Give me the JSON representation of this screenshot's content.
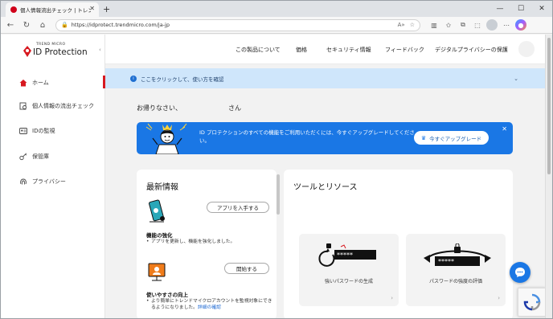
{
  "browser": {
    "tab_title": "個人情報流出チェック | トレンドマイクロ",
    "url": "https://idprotect.trendmicro.com/ja-jp",
    "window_controls": [
      "—",
      "☐",
      "✕"
    ]
  },
  "logo": {
    "small": "TREND MICRO",
    "big": "ID Protection"
  },
  "sidebar": {
    "items": [
      {
        "label": "ホーム",
        "icon": "home-icon"
      },
      {
        "label": "個人情報の流出チェック",
        "icon": "leak-check-icon"
      },
      {
        "label": "IDの監視",
        "icon": "id-card-icon"
      },
      {
        "label": "保管庫",
        "icon": "key-icon"
      },
      {
        "label": "プライバシー",
        "icon": "fingerprint-icon"
      }
    ]
  },
  "topnav": {
    "items": [
      "この製品について",
      "価格",
      "セキュリティ情報",
      "フィードバック",
      "デジタルプライバシーの保護"
    ]
  },
  "info_banner": {
    "text": "ここをクリックして、使い方を確認"
  },
  "greeting": {
    "prefix": "お帰りなさい、",
    "suffix": "さん"
  },
  "upgrade": {
    "text": "ID プロテクションのすべての機能をご利用いただくには、今すぐアップグレードしてください。",
    "button": "今すぐアップグレード",
    "accent": "#1a77e5"
  },
  "news": {
    "title": "最新情報",
    "items": [
      {
        "button": "アプリを入手する",
        "heading": "機能の強化",
        "text": "アプリを更新し、機能を強化しました。",
        "link": ""
      },
      {
        "button": "開始する",
        "heading": "使いやすさの向上",
        "text": "より簡単にトレンドマイクロアカウントを監視対象にできるようになりました。",
        "link": "詳細の確認"
      }
    ]
  },
  "tools": {
    "title": "ツールとリソース",
    "items": [
      {
        "label": "強いパスワードの生成"
      },
      {
        "label": "パスワードの強度の評価"
      }
    ]
  },
  "colors": {
    "brand_red": "#d71920",
    "info_bg": "#cfe6fb",
    "link": "#1a66d1"
  }
}
